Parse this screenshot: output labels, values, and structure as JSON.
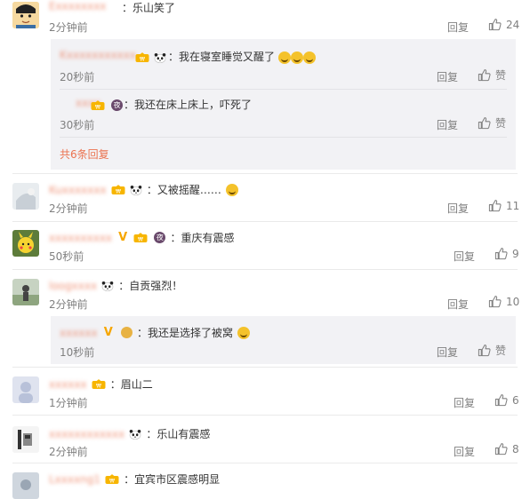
{
  "comments": [
    {
      "name": "Exxxxxxxx",
      "text": "：乐山笑了",
      "time": "2分钟前",
      "reply": "回复",
      "likes": "24"
    },
    {
      "name": "Kuxxxxxxx",
      "text": "：又被摇醒……",
      "time": "2分钟前",
      "reply": "回复",
      "likes": "11"
    },
    {
      "name": "xxxxxxxxxx",
      "text": "：重庆有震感",
      "time": "50秒前",
      "reply": "回复",
      "likes": "9"
    },
    {
      "name": "loogxxxx",
      "text": "：自贡强烈！",
      "time": "2分钟前",
      "reply": "回复",
      "likes": "10"
    },
    {
      "name": "xxxxxx",
      "text": "：眉山二",
      "time": "1分钟前",
      "reply": "回复",
      "likes": "6"
    },
    {
      "name": "xxxxxxxxxxxx",
      "text": "：乐山有震感",
      "time": "2分钟前",
      "reply": "回复",
      "likes": "8"
    },
    {
      "name": "Lxxxxng1",
      "text": "：宜宾市区震感明显"
    }
  ],
  "replies_1": [
    {
      "name": "Kxxxxxxxxxxx",
      "text": "：我在寝室睡觉又醒了",
      "time": "20秒前",
      "reply": "回复",
      "likes": "赞"
    },
    {
      "name": "xxxx",
      "text": "：我还在床上床上，吓死了",
      "time": "30秒前",
      "reply": "回复",
      "likes": "赞"
    }
  ],
  "more_replies": "共6条回复",
  "replies_4": [
    {
      "name": "xxxxxx",
      "text": "：我还是选择了被窝",
      "time": "10秒前",
      "reply": "回复",
      "likes": "赞"
    }
  ],
  "icons": {
    "like": "thumbs-up-icon",
    "emoji": "laughing-face-icon",
    "panda": "panda-icon"
  },
  "colors": {
    "username": "#eb7350",
    "text": "#333333",
    "meta": "#808080",
    "reply_bg": "#f2f2f5"
  }
}
